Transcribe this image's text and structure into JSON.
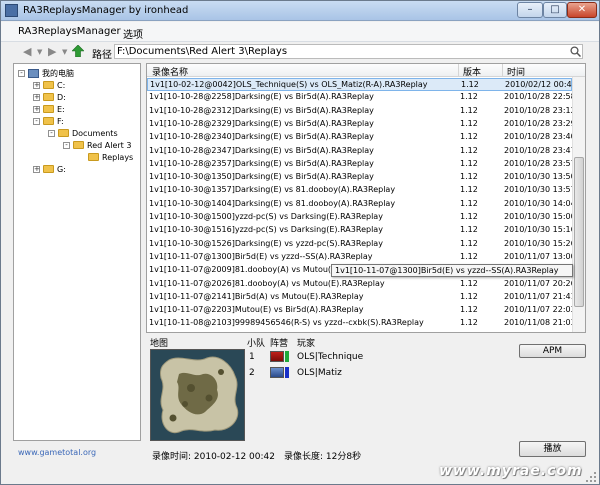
{
  "window": {
    "title": "RA3ReplaysManager by ironhead"
  },
  "menubar": {
    "items": [
      "RA3ReplaysManager",
      "选项"
    ]
  },
  "toolbar": {
    "path_label": "路径",
    "path_value": "F:\\Documents\\Red Alert 3\\Replays"
  },
  "tree": [
    {
      "label": "我的电脑",
      "type": "computer",
      "expander": "-"
    },
    {
      "label": "C:",
      "type": "folder",
      "expander": "+"
    },
    {
      "label": "D:",
      "type": "folder",
      "expander": "+"
    },
    {
      "label": "E:",
      "type": "folder",
      "expander": "+"
    },
    {
      "label": "F:",
      "type": "folder",
      "expander": "-"
    },
    {
      "label": "Documents",
      "type": "folder",
      "expander": "-"
    },
    {
      "label": "Red Alert 3",
      "type": "folder",
      "expander": "-"
    },
    {
      "label": "Replays",
      "type": "folder",
      "expander": ""
    },
    {
      "label": "G:",
      "type": "folder",
      "expander": "+"
    }
  ],
  "list": {
    "columns": [
      "录像名称",
      "版本",
      "时间"
    ],
    "rows": [
      {
        "name": "1v1[10-02-12@0042]OLS_Technique(S) vs OLS_Matiz(R-A).RA3Replay",
        "version": "1.12",
        "time": "2010/02/12 00:42",
        "selected": true
      },
      {
        "name": "1v1[10-10-28@2258]Darksing(E) vs Bir5d(A).RA3Replay",
        "version": "1.12",
        "time": "2010/10/28 22:58"
      },
      {
        "name": "1v1[10-10-28@2312]Darksing(E) vs Bir5d(A).RA3Replay",
        "version": "1.12",
        "time": "2010/10/28 23:12"
      },
      {
        "name": "1v1[10-10-28@2329]Darksing(E) vs Bir5d(A).RA3Replay",
        "version": "1.12",
        "time": "2010/10/28 23:29"
      },
      {
        "name": "1v1[10-10-28@2340]Darksing(E) vs Bir5d(A).RA3Replay",
        "version": "1.12",
        "time": "2010/10/28 23:40"
      },
      {
        "name": "1v1[10-10-28@2347]Darksing(E) vs Bir5d(A).RA3Replay",
        "version": "1.12",
        "time": "2010/10/28 23:47"
      },
      {
        "name": "1v1[10-10-28@2357]Darksing(E) vs Bir5d(A).RA3Replay",
        "version": "1.12",
        "time": "2010/10/28 23:57"
      },
      {
        "name": "1v1[10-10-30@1350]Darksing(E) vs Bir5d(A).RA3Replay",
        "version": "1.12",
        "time": "2010/10/30 13:50"
      },
      {
        "name": "1v1[10-10-30@1357]Darksing(E) vs 81.dooboy(A).RA3Replay",
        "version": "1.12",
        "time": "2010/10/30 13:57"
      },
      {
        "name": "1v1[10-10-30@1404]Darksing(E) vs 81.dooboy(A).RA3Replay",
        "version": "1.12",
        "time": "2010/10/30 14:04"
      },
      {
        "name": "1v1[10-10-30@1500]yzzd-pc(S) vs Darksing(E).RA3Replay",
        "version": "1.12",
        "time": "2010/10/30 15:00"
      },
      {
        "name": "1v1[10-10-30@1516]yzzd-pc(S) vs Darksing(E).RA3Replay",
        "version": "1.12",
        "time": "2010/10/30 15:16"
      },
      {
        "name": "1v1[10-10-30@1526]Darksing(E) vs yzzd-pc(S).RA3Replay",
        "version": "1.12",
        "time": "2010/10/30 15:26"
      },
      {
        "name": "1v1[10-11-07@1300]Bir5d(E) vs yzzd--SS(A).RA3Replay",
        "version": "1.12",
        "time": "2010/11/07 13:00"
      },
      {
        "name": "1v1[10-11-07@2009]81.dooboy(A) vs Mutou(E).RA3Replay",
        "version": "1.12",
        "time": "2010/11/07 20:09"
      },
      {
        "name": "1v1[10-11-07@2026]81.dooboy(A) vs Mutou(E).RA3Replay",
        "version": "1.12",
        "time": "2010/11/07 20:26"
      },
      {
        "name": "1v1[10-11-07@2141]Bir5d(A) vs Mutou(E).RA3Replay",
        "version": "1.12",
        "time": "2010/11/07 21:41"
      },
      {
        "name": "1v1[10-11-07@2203]Mutou(E) vs Bir5d(A).RA3Replay",
        "version": "1.12",
        "time": "2010/11/07 22:03"
      },
      {
        "name": "1v1[10-11-08@2103]99989456546(R-S) vs yzzd--cxbk(S).RA3Replay",
        "version": "1.12",
        "time": "2010/11/08 21:03"
      }
    ],
    "tooltip": "1v1[10-11-07@1300]Bir5d(E) vs yzzd--SS(A).RA3Replay"
  },
  "details": {
    "map_label": "地图",
    "team_label": "小队",
    "faction_label": "阵营",
    "player_label": "玩家",
    "players": [
      {
        "team": "1",
        "name": "OLS|Technique",
        "faction": "soviet-icon",
        "color": "#1faa3c"
      },
      {
        "team": "2",
        "name": "OLS|Matiz",
        "faction": "allied-icon",
        "color": "#1830c8"
      }
    ],
    "apm_label": "APM",
    "play_label": "播放",
    "time_text": "录像时间: 2010-02-12 00:42",
    "length_text": "录像长度: 12分8秒"
  },
  "footer": {
    "site": "www.gametotal.org",
    "watermark": "www.myrae.com"
  }
}
